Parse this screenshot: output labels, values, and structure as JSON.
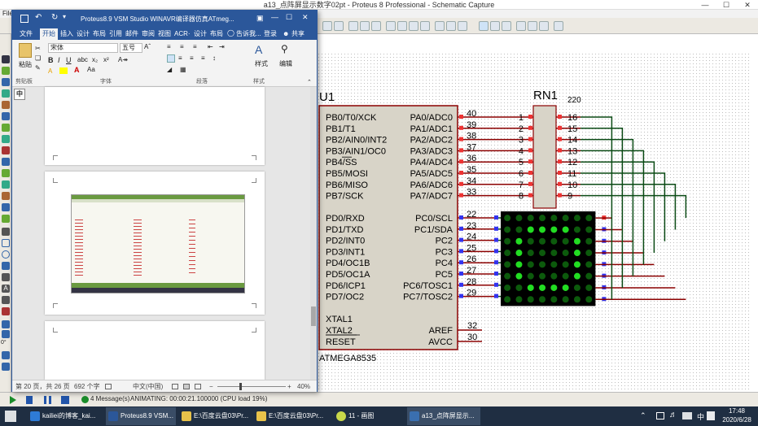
{
  "proteus": {
    "title": "a13_点阵屏显示数字02pt - Proteus 8 Professional - Schematic Capture",
    "menu_partial": "File",
    "status_msgs": "4 Message(s)",
    "status_anim": "ANIMATING: 00:00:21.100000 (CPU load 19%)",
    "angle": "0°"
  },
  "word": {
    "title": "Proteus8.9 VSM Studio WINAVR编译器仿真ATmeg...",
    "tabs": [
      "文件",
      "开始",
      "插入",
      "设计",
      "布局",
      "引用",
      "邮件",
      "审阅",
      "视图",
      "ACR·",
      "设计",
      "布局"
    ],
    "tell_me": "告诉我...",
    "login": "登录",
    "share": "共享",
    "paste": "粘贴",
    "clipboard": "剪贴板",
    "font_name": "宋体",
    "font_size": "五号",
    "font_group": "字体",
    "para_group": "段落",
    "style_btn": "样式",
    "style_group": "样式",
    "edit_btn": "编辑",
    "ime": "中",
    "page_info": "第 20 页，共 26 页",
    "word_count": "692 个字",
    "lang": "中文(中国)",
    "zoom": "40%"
  },
  "schematic": {
    "u1_ref": "U1",
    "u1_part": "ATMEGA8535",
    "rn1_ref": "RN1",
    "rn1_value": "220",
    "left_pins": [
      "PB0/T0/XCK",
      "PB1/T1",
      "PB2/AIN0/INT2",
      "PB3/AIN1/OC0",
      "PB4/SS",
      "PB5/MOSI",
      "PB6/MISO",
      "PB7/SCK",
      "PD0/RXD",
      "PD1/TXD",
      "PD2/INT0",
      "PD3/INT1",
      "PD4/OC1B",
      "PD5/OC1A",
      "PD6/ICP1",
      "PD7/OC2",
      "XTAL1",
      "XTAL2",
      "RESET"
    ],
    "right_pins": [
      "PA0/ADC0",
      "PA1/ADC1",
      "PA2/ADC2",
      "PA3/ADC3",
      "PA4/ADC4",
      "PA5/ADC5",
      "PA6/ADC6",
      "PA7/ADC7",
      "PC0/SCL",
      "PC1/SDA",
      "PC2",
      "PC3",
      "PC4",
      "PC5",
      "PC6/TOSC1",
      "PC7/TOSC2",
      "AREF",
      "AVCC"
    ],
    "pa_nums": [
      "40",
      "39",
      "38",
      "37",
      "36",
      "35",
      "34",
      "33"
    ],
    "pc_nums": [
      "22",
      "23",
      "24",
      "25",
      "26",
      "27",
      "28",
      "29"
    ],
    "aref_nums": [
      "32",
      "30"
    ],
    "rn_left": [
      "1",
      "2",
      "3",
      "4",
      "5",
      "6",
      "7",
      "8"
    ],
    "rn_right": [
      "16",
      "15",
      "14",
      "13",
      "12",
      "11",
      "10",
      "9"
    ],
    "matrix_on": [
      [
        0,
        0,
        0,
        0,
        0,
        0,
        0,
        0
      ],
      [
        0,
        0,
        1,
        1,
        1,
        1,
        0,
        0
      ],
      [
        0,
        1,
        0,
        0,
        0,
        0,
        1,
        0
      ],
      [
        0,
        1,
        0,
        0,
        0,
        0,
        1,
        0
      ],
      [
        0,
        1,
        0,
        0,
        0,
        0,
        1,
        0
      ],
      [
        0,
        1,
        0,
        0,
        0,
        0,
        1,
        0
      ],
      [
        0,
        0,
        1,
        1,
        1,
        1,
        0,
        0
      ],
      [
        0,
        0,
        0,
        0,
        0,
        0,
        0,
        0
      ]
    ],
    "colors": {
      "wire": "#0a4a14",
      "pin": "#8b0000",
      "led_on": "#22dd22",
      "led_off": "#0c5a0c",
      "body": "#d8d4c8"
    }
  },
  "taskbar": {
    "items": [
      "kailiei的博客_kai...",
      "Proteus8.9 VSM...",
      "E:\\百度云盘03\\Pr...",
      "E:\\百度云盘03\\Pr...",
      "11 - 画图",
      "a13_点阵屏显示..."
    ],
    "time": "17:48",
    "date": "2020/6/28",
    "tray": "中"
  }
}
